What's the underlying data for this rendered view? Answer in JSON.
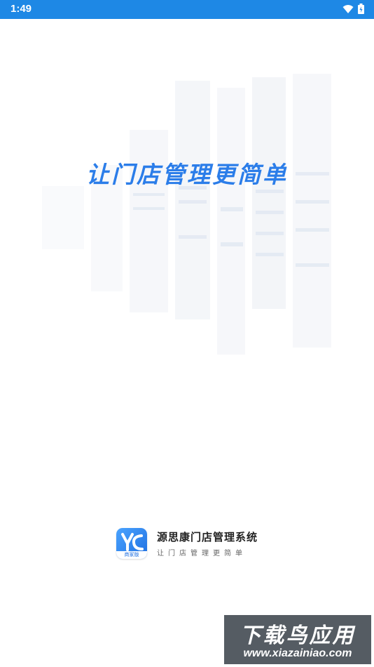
{
  "status_bar": {
    "time": "1:49",
    "icons": [
      "wifi-icon",
      "battery-icon"
    ],
    "color": "#1e88e5"
  },
  "splash": {
    "tagline": "让门店管理更简单",
    "accent_color": "#2b7de9"
  },
  "brand": {
    "icon_badge": "商家版",
    "name": "源思康门店管理系统",
    "slogan": "让门店管理更简单"
  },
  "watermark": {
    "title": "下载鸟应用",
    "url": "www.xiazainiao.com"
  }
}
